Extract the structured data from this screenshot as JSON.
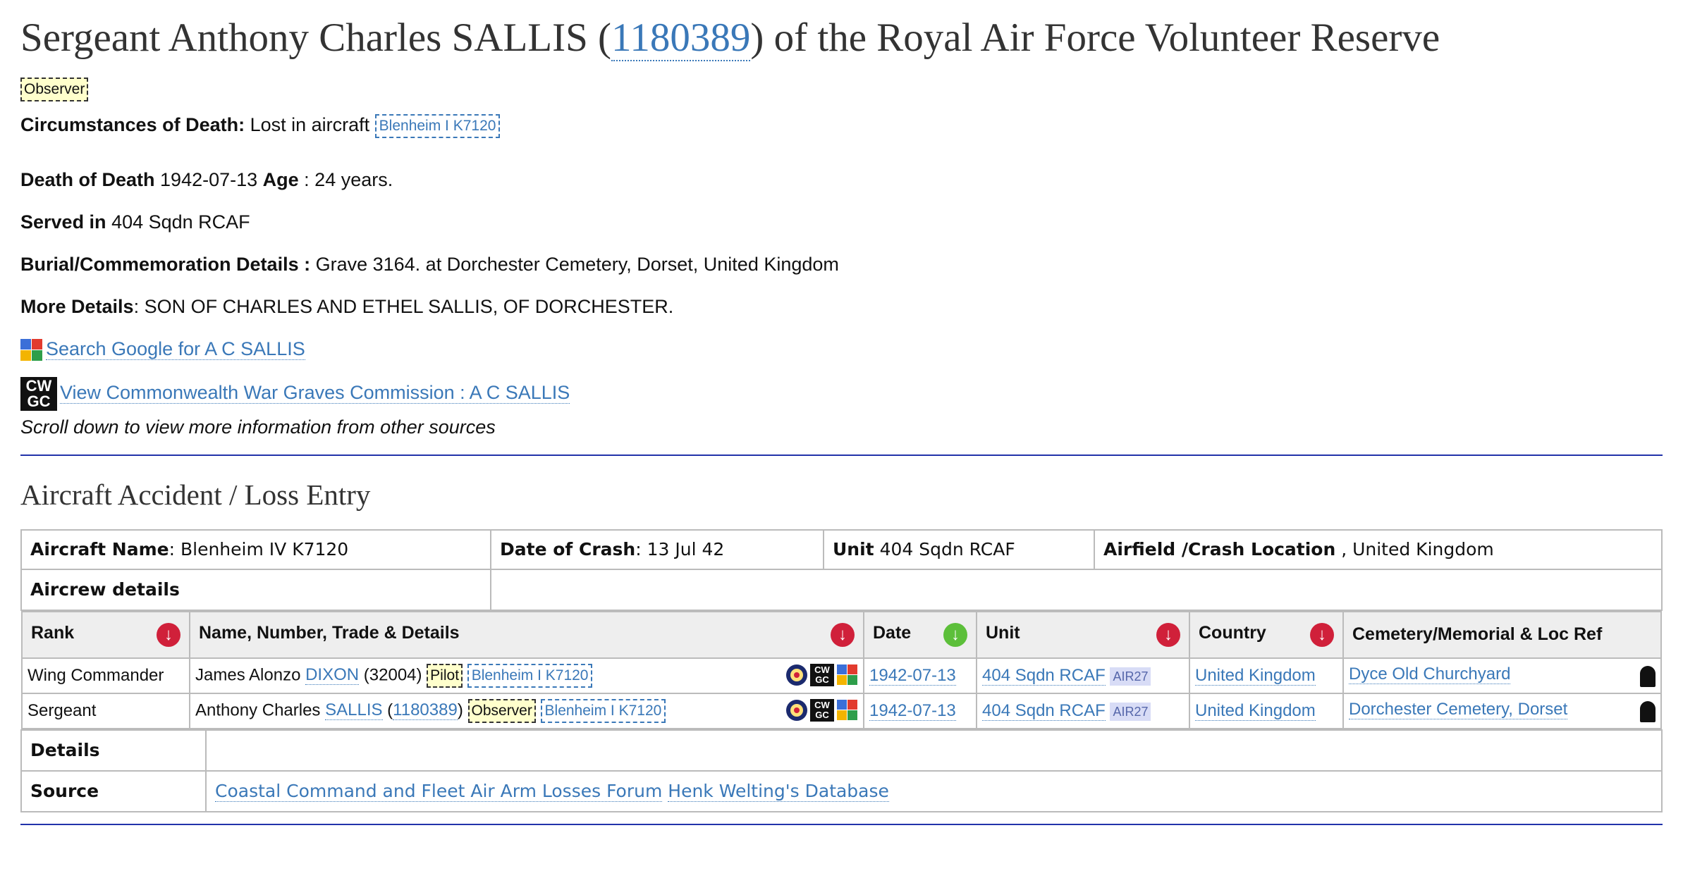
{
  "title": {
    "prefix": "Sergeant Anthony Charles SALLIS (",
    "service_number": "1180389",
    "suffix": ") of the Royal Air Force Volunteer Reserve"
  },
  "trade_badge": "Observer",
  "circumstances": {
    "label": "Circumstances of Death:",
    "text": " Lost in aircraft ",
    "aircraft_link": "Blenheim I K7120"
  },
  "death": {
    "label": "Death of Death",
    "date": " 1942-07-13 ",
    "age_label": "Age",
    "age_text": " : 24 years."
  },
  "served": {
    "label": "Served in",
    "value": " 404 Sqdn RCAF"
  },
  "burial": {
    "label": "Burial/Commemoration Details :",
    "value": " Grave 3164. at Dorchester Cemetery, Dorset, United Kingdom"
  },
  "more": {
    "label": "More Details",
    "value": ": SON OF CHARLES AND ETHEL SALLIS, OF DORCHESTER."
  },
  "links": {
    "google": "Search Google for A C SALLIS",
    "cwgc": "View Commonwealth War Graves Commission : A C SALLIS",
    "cwgc_icon_text_1": "CW",
    "cwgc_icon_text_2": "GC"
  },
  "scroll_note": "Scroll down to view more information from other sources",
  "section_title": "Aircraft Accident / Loss Entry",
  "summary": {
    "aircraft_label": "Aircraft Name",
    "aircraft_value": ": Blenheim IV K7120",
    "date_label": "Date of Crash",
    "date_value": ": 13 Jul 42",
    "unit_label": "Unit",
    "unit_value": " 404 Sqdn RCAF",
    "airfield_label": "Airfield /Crash Location",
    "airfield_value": " , United Kingdom",
    "aircrew_label": "Aircrew details"
  },
  "crew_headers": {
    "rank": "Rank",
    "name": "Name, Number, Trade & Details",
    "date": "Date",
    "unit": "Unit",
    "country": "Country",
    "cemetery": "Cemetery/Memorial & Loc Ref",
    "arrow_down": "↓"
  },
  "crew": [
    {
      "rank": "Wing Commander",
      "first": "James Alonzo ",
      "surname": "DIXON",
      "number_pre": " (32004) ",
      "number_link": "",
      "number_post": "",
      "trade": "Pilot",
      "aircraft": "Blenheim I K7120",
      "date": "1942-07-13",
      "unit": "404 Sqdn RCAF",
      "air": "AIR27",
      "country": "United Kingdom",
      "cemetery": "Dyce Old Churchyard"
    },
    {
      "rank": "Sergeant",
      "first": "Anthony Charles ",
      "surname": "SALLIS",
      "number_pre": " (",
      "number_link": "1180389",
      "number_post": ") ",
      "trade": "Observer",
      "aircraft": "Blenheim I K7120",
      "date": "1942-07-13",
      "unit": "404 Sqdn RCAF",
      "air": "AIR27",
      "country": "United Kingdom",
      "cemetery": "Dorchester Cemetery, Dorset"
    }
  ],
  "details_label": "Details",
  "source_label": "Source",
  "sources": [
    "Coastal Command and Fleet Air Arm Losses Forum",
    "Henk Welting's Database"
  ],
  "colors": {
    "link": "#3a78b8",
    "rule": "#2233aa",
    "red_arrow": "#d0203a",
    "green_arrow": "#5cbf3a"
  }
}
